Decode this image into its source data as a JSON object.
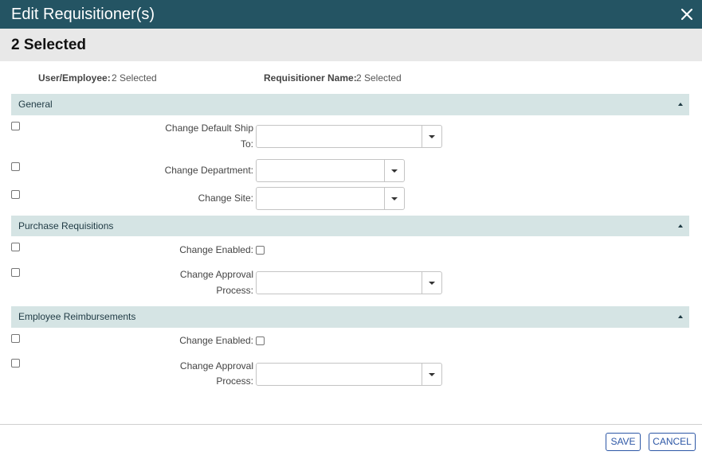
{
  "dialog": {
    "title": "Edit Requisitioner(s)",
    "close_icon": "close-icon",
    "subtitle": "2 Selected"
  },
  "info": {
    "user_label": "User/Employee:",
    "user_value": "2 Selected",
    "name_label": "Requisitioner Name:",
    "name_value": "2 Selected"
  },
  "sections": {
    "general": {
      "title": "General",
      "ship_to_label_1": "Change Default Ship",
      "ship_to_label_2": "To:",
      "department_label": "Change Department:",
      "site_label": "Change Site:"
    },
    "purchase": {
      "title": "Purchase Requisitions",
      "enabled_label": "Change Enabled:",
      "approval_label_1": "Change Approval",
      "approval_label_2": "Process:"
    },
    "reimbursement": {
      "title": "Employee Reimbursements",
      "enabled_label": "Change Enabled:",
      "approval_label_1": "Change Approval",
      "approval_label_2": "Process:"
    }
  },
  "footer": {
    "save_label": "SAVE",
    "cancel_label": "CANCEL"
  },
  "colors": {
    "titlebar": "#245463",
    "section": "#d5e4e4",
    "accent": "#2d57a6"
  }
}
